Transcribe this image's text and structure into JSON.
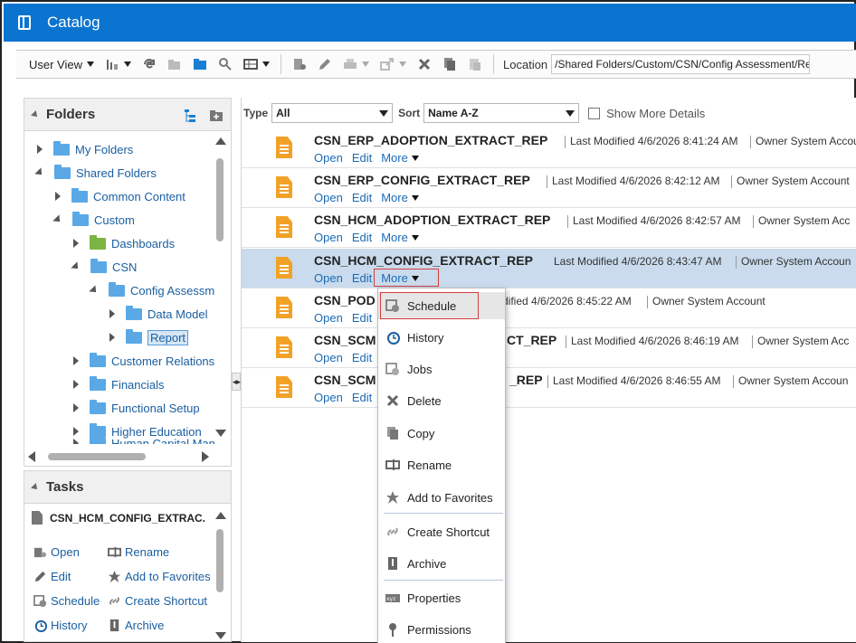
{
  "header": {
    "title": "Catalog",
    "accent": "#0b74d0"
  },
  "toolbar": {
    "user_view": "User View",
    "location_label": "Location",
    "location_value": "/Shared Folders/Custom/CSN/Config Assessment/Report"
  },
  "folders_panel": {
    "title": "Folders",
    "tree": [
      {
        "label": "My Folders"
      },
      {
        "label": "Shared Folders"
      },
      {
        "label": "Common Content"
      },
      {
        "label": "Custom"
      },
      {
        "label": "Dashboards"
      },
      {
        "label": "CSN"
      },
      {
        "label": "Config Assessme"
      },
      {
        "label": "Data Model"
      },
      {
        "label": "Report"
      },
      {
        "label": "Customer Relationsl"
      },
      {
        "label": "Financials"
      },
      {
        "label": "Functional Setup"
      },
      {
        "label": "Higher Education"
      },
      {
        "label": "Human Capital Man"
      }
    ]
  },
  "tasks_panel": {
    "title": "Tasks",
    "selected_item": "CSN_HCM_CONFIG_EXTRAC.",
    "tasks": [
      {
        "label": "Open"
      },
      {
        "label": "Rename"
      },
      {
        "label": "Edit"
      },
      {
        "label": "Add to Favorites"
      },
      {
        "label": "Schedule"
      },
      {
        "label": "Create Shortcut"
      },
      {
        "label": "History"
      },
      {
        "label": "Archive"
      }
    ]
  },
  "filter": {
    "type_label": "Type",
    "type_value": "All",
    "sort_label": "Sort",
    "sort_value": "Name A-Z",
    "show_more": "Show More Details"
  },
  "items": [
    {
      "name": "CSN_ERP_ADOPTION_EXTRACT_REP",
      "modified": "Last Modified 4/6/2026 8:41:24 AM",
      "owner": "Owner System Accou"
    },
    {
      "name": "CSN_ERP_CONFIG_EXTRACT_REP",
      "modified": "Last Modified 4/6/2026 8:42:12 AM",
      "owner": "Owner System Account"
    },
    {
      "name": "CSN_HCM_ADOPTION_EXTRACT_REP",
      "modified": "Last Modified 4/6/2026 8:42:57 AM",
      "owner": "Owner System Acc"
    },
    {
      "name": "CSN_HCM_CONFIG_EXTRACT_REP",
      "modified": "Last Modified 4/6/2026 8:43:47 AM",
      "owner": "Owner System Accoun"
    },
    {
      "name": "CSN_POD",
      "modified": "dified 4/6/2026 8:45:22 AM",
      "owner": "Owner System Account"
    },
    {
      "name": "CSN_SCM",
      "name_tail": "CT_REP",
      "modified": "Last Modified 4/6/2026 8:46:19 AM",
      "owner": "Owner System Acc"
    },
    {
      "name": "CSN_SCM",
      "name_tail": "_REP",
      "modified": "Last Modified 4/6/2026 8:46:55 AM",
      "owner": "Owner System Accoun"
    }
  ],
  "row_actions": {
    "open": "Open",
    "edit": "Edit",
    "more": "More"
  },
  "menu": {
    "items": [
      {
        "label": "Schedule"
      },
      {
        "label": "History"
      },
      {
        "label": "Jobs"
      },
      {
        "label": "Delete"
      },
      {
        "label": "Copy"
      },
      {
        "label": "Rename"
      },
      {
        "label": "Add to Favorites"
      },
      {
        "label": "Create Shortcut"
      },
      {
        "label": "Archive"
      },
      {
        "label": "Properties"
      },
      {
        "label": "Permissions"
      }
    ]
  }
}
